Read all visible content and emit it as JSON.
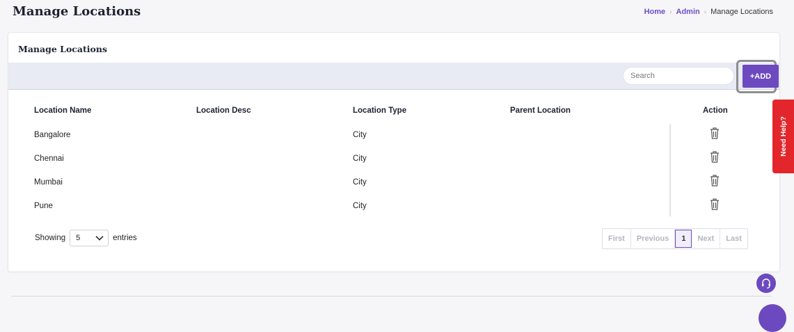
{
  "page": {
    "title": "Manage Locations"
  },
  "breadcrumb": {
    "home": "Home",
    "admin": "Admin",
    "current": "Manage Locations",
    "separator": "›"
  },
  "card": {
    "title": "Manage Locations"
  },
  "toolbar": {
    "search_placeholder": "Search",
    "add_label": "+ADD"
  },
  "table": {
    "headers": [
      "Location Name",
      "Location Desc",
      "Location Type",
      "Parent Location",
      "Action"
    ],
    "rows": [
      {
        "name": "Bangalore",
        "desc": "",
        "type": "City",
        "parent": ""
      },
      {
        "name": "Chennai",
        "desc": "",
        "type": "City",
        "parent": ""
      },
      {
        "name": "Mumbai",
        "desc": "",
        "type": "City",
        "parent": ""
      },
      {
        "name": "Pune",
        "desc": "",
        "type": "City",
        "parent": ""
      }
    ],
    "action_icon": "trash-icon"
  },
  "pagination": {
    "showing_label": "Showing",
    "page_size": "5",
    "entries_label": "entries",
    "first": "First",
    "previous": "Previous",
    "current_page": "1",
    "next": "Next",
    "last": "Last"
  },
  "help": {
    "label": "Need Help?"
  },
  "colors": {
    "accent": "#6c49bf",
    "help": "#e3262b",
    "toolbar_bg": "#e8eaf4"
  },
  "icons": {
    "support": "headset-icon",
    "dropdown": "chevron-down-icon"
  }
}
